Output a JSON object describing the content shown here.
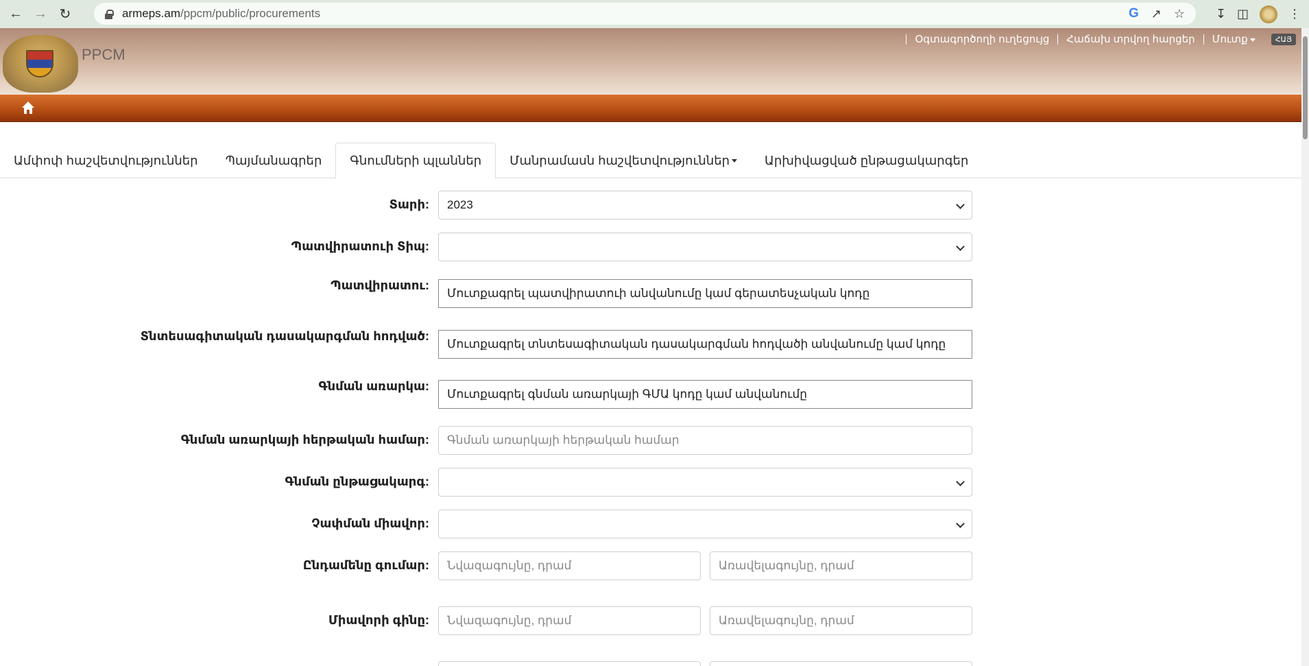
{
  "browser": {
    "url_domain": "armeps.am",
    "url_path": "/ppcm/public/procurements"
  },
  "site": {
    "brand": "PPCM",
    "top_links": [
      "Օգտագործողի ուղեցույց",
      "Հաճախ տրվող հարցեր",
      "Մուտք"
    ],
    "lang_badge": "ՀԱՅ"
  },
  "tabs": [
    {
      "label": "Ամփոփ հաշվետվություններ",
      "active": false
    },
    {
      "label": "Պայմանագրեր",
      "active": false
    },
    {
      "label": "Գնումների պլաններ",
      "active": true
    },
    {
      "label": "Մանրամասն հաշվետվություններ",
      "active": false,
      "dropdown": true
    },
    {
      "label": "Արխիվացված ընթացակարգեր",
      "active": false
    }
  ],
  "form": {
    "year": {
      "label": "Տարի:",
      "value": "2023"
    },
    "customer_type": {
      "label": "Պատվիրատուի Տիպ:",
      "value": ""
    },
    "customer": {
      "label": "Պատվիրատու:",
      "value": "Մուտքագրել պատվիրատուի անվանումը կամ գերատեսչական կոդը"
    },
    "econ_class": {
      "label": "Տնտեսագիտական դասակարգման հոդված:",
      "value": "Մուտքագրել տնտեսագիտական դասակարգման հոդվածի անվանումը կամ կոդը"
    },
    "subject": {
      "label": "Գնման առարկա:",
      "value": "Մուտքագրել գնման առարկայի ԳՄԱ կոդը կամ անվանումը"
    },
    "serial": {
      "label": "Գնման առարկայի հերթական համար:",
      "placeholder": "Գնման առարկայի հերթական համար"
    },
    "procedure": {
      "label": "Գնման ընթացակարգ:",
      "value": ""
    },
    "unit": {
      "label": "Չափման միավոր:",
      "value": ""
    },
    "total": {
      "label": "Ընդամենը գումար:",
      "min_placeholder": "Նվազագույնը, դրամ",
      "max_placeholder": "Առավելագույնը, դրամ"
    },
    "unit_price": {
      "label": "Միավորի գինը:",
      "min_placeholder": "Նվազագույնը, դրամ",
      "max_placeholder": "Առավելագույնը, դրամ"
    }
  }
}
